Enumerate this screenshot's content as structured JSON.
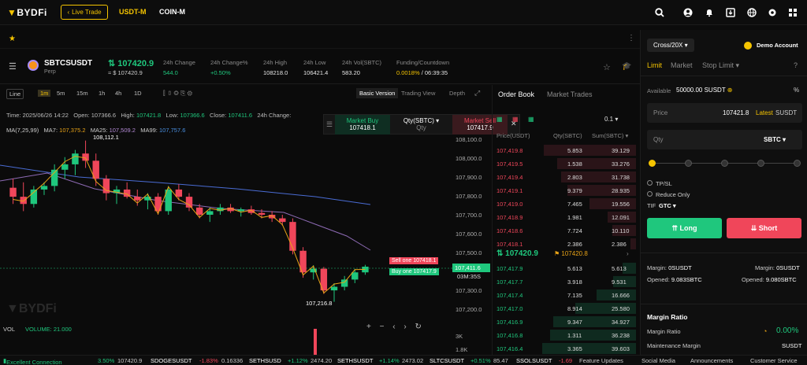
{
  "nav": {
    "logo": "BYDFi",
    "live_trade": "Live Trade",
    "usdt_m": "USDT-M",
    "coin_m": "COIN-M",
    "icons": [
      "search-icon",
      "user-icon",
      "bell-icon",
      "download-icon",
      "globe-icon",
      "gear-icon",
      "grid-icon"
    ]
  },
  "symbol": {
    "name": "SBTCSUSDT",
    "type": "Perp",
    "price": "107420.9",
    "usd_price": "≈ $ 107420.9",
    "stats": [
      {
        "label": "24h Change",
        "value": "544.0",
        "color": "green"
      },
      {
        "label": "24h Change%",
        "value": "+0.50%",
        "color": "green"
      },
      {
        "label": "24h High",
        "value": "108218.0",
        "color": "white"
      },
      {
        "label": "24h Low",
        "value": "106421.4",
        "color": "white"
      },
      {
        "label": "24h Vol(SBTC)",
        "value": "583.20",
        "color": "white"
      }
    ],
    "funding_label": "Funding/Countdown",
    "funding_rate": "0.0018%",
    "countdown": "/ 06:39:35"
  },
  "toolbar": {
    "line": "Line",
    "timeframes": [
      "1m",
      "5m",
      "15m",
      "1h",
      "4h",
      "1D"
    ],
    "basic_version": "Basic Version",
    "trading_view": "Trading View",
    "depth": "Depth"
  },
  "chart": {
    "time_label": "Time:",
    "time": "2025/06/26 14:22",
    "open_label": "Open:",
    "open": "107366.6",
    "high_label": "High:",
    "high": "107421.8",
    "low_label": "Low:",
    "low": "107366.6",
    "close_label": "Close:",
    "close": "107411.6",
    "change_label": "24h Change:",
    "ma_label": "MA(7,25,99)",
    "ma7_label": "MA7:",
    "ma7": "107,375.2",
    "ma25_label": "MA25:",
    "ma25": "107,509.2",
    "ma99_label": "MA99:",
    "ma99": "107,757.6",
    "high_marker": "108,112.1",
    "low_marker": "107,216.8",
    "vol_label": "VOL",
    "volume": "VOLUME: 21.000",
    "price_axis": [
      "108,100.0",
      "108,000.0",
      "107,900.0",
      "107,800.0",
      "107,700.0",
      "107,600.0",
      "107,500.0",
      "107,300.0",
      "107,200.0"
    ],
    "current_price": "107,411.6",
    "countdown": "03M:35S",
    "sell_one": "Sell one  107418.1",
    "buy_one": "Buy one  107417.9",
    "vol_axis": [
      "3K",
      "1.8K"
    ]
  },
  "chart_data": {
    "type": "candlestick",
    "candles": [
      [
        107850,
        107900,
        107760,
        107800
      ],
      [
        107800,
        107880,
        107720,
        107760
      ],
      [
        107760,
        107860,
        107740,
        107840
      ],
      [
        107840,
        107880,
        107810,
        107860
      ],
      [
        107860,
        107980,
        107830,
        107950
      ],
      [
        107950,
        108020,
        107900,
        107980
      ],
      [
        107980,
        108060,
        107920,
        108040
      ],
      [
        108040,
        108112.1,
        107960,
        108000
      ],
      [
        108000,
        108040,
        107860,
        107900
      ],
      [
        107900,
        107920,
        107780,
        107820
      ],
      [
        107820,
        107860,
        107760,
        107840
      ],
      [
        107840,
        107880,
        107790,
        107800
      ],
      [
        107800,
        107840,
        107750,
        107780
      ],
      [
        107780,
        107820,
        107730,
        107800
      ],
      [
        107800,
        107820,
        107700,
        107720
      ],
      [
        107720,
        107860,
        107700,
        107840
      ],
      [
        107840,
        107870,
        107780,
        107800
      ],
      [
        107800,
        107820,
        107720,
        107740
      ],
      [
        107740,
        107760,
        107680,
        107700
      ],
      [
        107700,
        107740,
        107660,
        107720
      ],
      [
        107720,
        107760,
        107700,
        107740
      ],
      [
        107740,
        107760,
        107710,
        107720
      ],
      [
        107720,
        107740,
        107690,
        107730
      ],
      [
        107730,
        107750,
        107700,
        107710
      ],
      [
        107710,
        107730,
        107680,
        107700
      ],
      [
        107700,
        107720,
        107660,
        107680
      ],
      [
        107680,
        107700,
        107640,
        107660
      ],
      [
        107660,
        107680,
        107480,
        107500
      ],
      [
        107500,
        107520,
        107350,
        107380
      ],
      [
        107380,
        107420,
        107340,
        107400
      ],
      [
        107400,
        107410,
        107260,
        107280
      ],
      [
        107280,
        107320,
        107216.8,
        107300
      ],
      [
        107300,
        107360,
        107280,
        107340
      ],
      [
        107340,
        107400,
        107320,
        107380
      ],
      [
        107380,
        107421.8,
        107366.6,
        107411.6
      ]
    ]
  },
  "order_book": {
    "title": "Order Book",
    "market_trades": "Market Trades",
    "precision": "0.1",
    "col_price": "Price(USDT)",
    "col_qty": "Qty(SBTC)",
    "col_sum": "Sum(SBTC)",
    "asks": [
      [
        "107,419.8",
        "5.853",
        "39.129"
      ],
      [
        "107,419.5",
        "1.538",
        "33.276"
      ],
      [
        "107,419.4",
        "2.803",
        "31.738"
      ],
      [
        "107,419.1",
        "9.379",
        "28.935"
      ],
      [
        "107,419.0",
        "7.465",
        "19.556"
      ],
      [
        "107,418.9",
        "1.981",
        "12.091"
      ],
      [
        "107,418.6",
        "7.724",
        "10.110"
      ],
      [
        "107,418.1",
        "2.386",
        "2.386"
      ]
    ],
    "mid_price": "107420.9",
    "mark_price": "107420.8",
    "bids": [
      [
        "107,417.9",
        "5.613",
        "5.613"
      ],
      [
        "107,417.7",
        "3.918",
        "9.531"
      ],
      [
        "107,417.4",
        "7.135",
        "16.666"
      ],
      [
        "107,417.0",
        "8.914",
        "25.580"
      ],
      [
        "107,416.9",
        "9.347",
        "34.927"
      ],
      [
        "107,416.8",
        "1.311",
        "36.238"
      ],
      [
        "107,416.4",
        "3.365",
        "39.603"
      ]
    ]
  },
  "quick": {
    "market_buy": "Market Buy",
    "market_buy_price": "107418.1",
    "qty": "Qty(SBTC) ▾",
    "qty_label": "Qty",
    "market_sell": "Market Sell",
    "market_sell_price": "107417.9"
  },
  "trade": {
    "cross": "Cross/20X",
    "demo": "Demo Account",
    "tabs": [
      "Limit",
      "Market",
      "Stop Limit ▾"
    ],
    "available_label": "Available",
    "available": "50000.00 SUSDT",
    "price_label": "Price",
    "price": "107421.8",
    "latest": "Latest",
    "unit": "SUSDT",
    "qty_placeholder": "Qty",
    "qty_unit": "SBTC ▾",
    "tpsl": "TP/SL",
    "reduce_only": "Reduce Only",
    "tif_label": "TIF",
    "tif": "GTC ▾",
    "long": "Long",
    "short": "Short",
    "margin_left_label": "Margin:",
    "margin_left": "0SUSDT",
    "margin_right_label": "Margin:",
    "margin_right": "0SUSDT",
    "opened_left_label": "Opened:",
    "opened_left": "9.083SBTC",
    "opened_right_label": "Opened:",
    "opened_right": "9.080SBTC",
    "margin_ratio_title": "Margin Ratio",
    "margin_ratio_label": "Margin Ratio",
    "margin_ratio": "0.00%",
    "maintenance_label": "Maintenance Margin",
    "maintenance_unit": "SUSDT"
  },
  "ticker": {
    "connection": "Excellent Connection",
    "items": [
      [
        "3.50%",
        "107420.9"
      ],
      [
        "SDOGESUSDT",
        "-1.83%",
        "0.16336"
      ],
      [
        "SETHSUSD",
        "+1.12%",
        "2474.20"
      ],
      [
        "SETHSUSDT",
        "+1.14%",
        "2473.02"
      ],
      [
        "SLTCSUSDT",
        "+0.51%",
        "85.47"
      ],
      [
        "SSOLSUSDT",
        "-1.69"
      ]
    ],
    "links": [
      "Feature Updates",
      "Social Media",
      "Announcements",
      "Customer Service"
    ]
  },
  "colors": {
    "green": "#1fc77d",
    "red": "#f0465a",
    "yellow": "#f5c400"
  }
}
